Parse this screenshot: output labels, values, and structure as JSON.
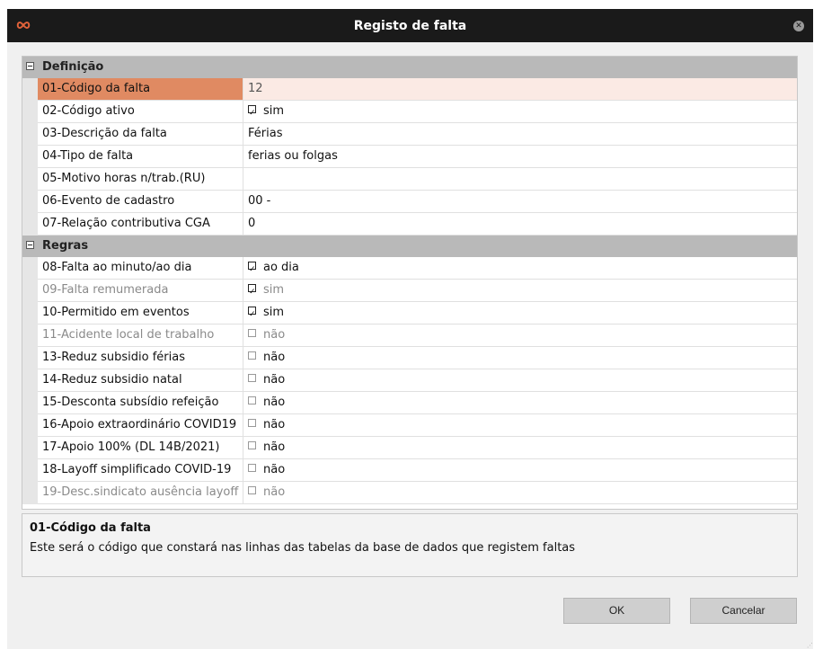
{
  "window": {
    "title": "Registo de falta",
    "logo_icon": "infinity-logo-icon",
    "close_icon": "close-icon"
  },
  "categories": {
    "definicao": "Definição",
    "regras": "Regras"
  },
  "properties": [
    {
      "name": "01-Código da falta",
      "value": "12",
      "selected": true
    },
    {
      "name": "02-Código ativo",
      "value": "sim",
      "checkbox": true,
      "checked": true
    },
    {
      "name": "03-Descrição da falta",
      "value": "Férias"
    },
    {
      "name": "04-Tipo de falta",
      "value": "ferias ou folgas"
    },
    {
      "name": "05-Motivo horas n/trab.(RU)",
      "value": ""
    },
    {
      "name": "06-Evento de cadastro",
      "value": "00 -"
    },
    {
      "name": "07-Relação contributiva CGA",
      "value": "0"
    },
    {
      "name": "08-Falta ao minuto/ao dia",
      "value": "ao dia",
      "checkbox": true,
      "checked": true
    },
    {
      "name": "09-Falta remumerada",
      "value": "sim",
      "checkbox": true,
      "checked": true,
      "dim": true
    },
    {
      "name": "10-Permitido em eventos",
      "value": "sim",
      "checkbox": true,
      "checked": true
    },
    {
      "name": "11-Acidente local de trabalho",
      "value": "não",
      "checkbox": true,
      "checked": false,
      "dim": true
    },
    {
      "name": "13-Reduz subsidio férias",
      "value": "não",
      "checkbox": true,
      "checked": false
    },
    {
      "name": "14-Reduz subsidio natal",
      "value": "não",
      "checkbox": true,
      "checked": false
    },
    {
      "name": "15-Desconta subsídio refeição",
      "value": "não",
      "checkbox": true,
      "checked": false
    },
    {
      "name": "16-Apoio extraordinário COVID19",
      "value": "não",
      "checkbox": true,
      "checked": false
    },
    {
      "name": "17-Apoio 100% (DL 14B/2021)",
      "value": "não",
      "checkbox": true,
      "checked": false
    },
    {
      "name": "18-Layoff simplificado COVID-19",
      "value": "não",
      "checkbox": true,
      "checked": false
    },
    {
      "name": "19-Desc.sindicato ausência layoff",
      "value": "não",
      "checkbox": true,
      "checked": false,
      "dim": true
    }
  ],
  "description": {
    "title": "01-Código da falta",
    "text": "Este será o código que constará nas linhas das tabelas da base de dados que registem faltas"
  },
  "buttons": {
    "ok": "OK",
    "cancel": "Cancelar"
  }
}
